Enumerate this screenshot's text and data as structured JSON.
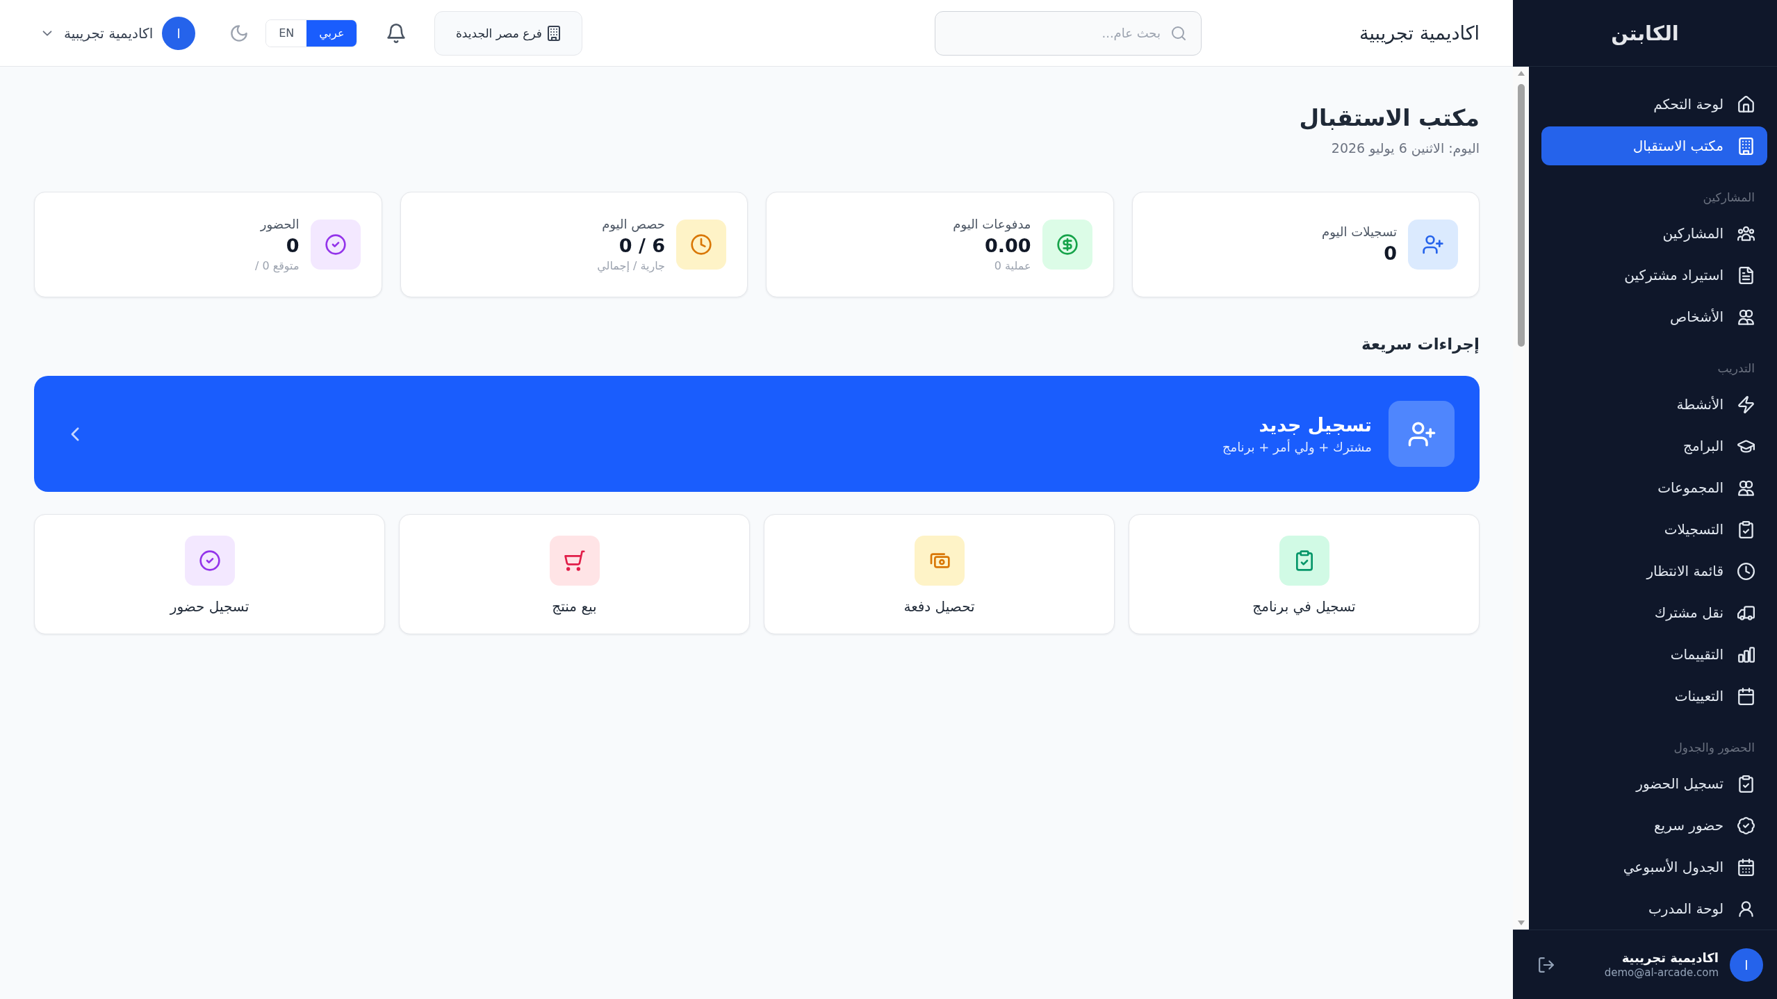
{
  "sidebar": {
    "brand": "الكابتن",
    "groups": [
      {
        "items": [
          {
            "label": "لوحة التحكم",
            "selected": false
          },
          {
            "label": "مكتب الاستقبال",
            "selected": true
          }
        ]
      },
      {
        "title": "المشاركين",
        "items": [
          {
            "label": "المشاركين",
            "selected": false
          },
          {
            "label": "استيراد مشتركين",
            "selected": false
          },
          {
            "label": "الأشخاص",
            "selected": false
          }
        ]
      },
      {
        "title": "التدريب",
        "items": [
          {
            "label": "الأنشطة",
            "selected": false
          },
          {
            "label": "البرامج",
            "selected": false
          },
          {
            "label": "المجموعات",
            "selected": false
          },
          {
            "label": "التسجيلات",
            "selected": false
          },
          {
            "label": "قائمة الانتظار",
            "selected": false
          },
          {
            "label": "نقل مشترك",
            "selected": false
          },
          {
            "label": "التقييمات",
            "selected": false
          },
          {
            "label": "التعيينات",
            "selected": false
          }
        ]
      },
      {
        "title": "الحضور والجدول",
        "items": [
          {
            "label": "تسجيل الحضور",
            "selected": false
          },
          {
            "label": "حضور سريع",
            "selected": false
          },
          {
            "label": "الجدول الأسبوعي",
            "selected": false
          },
          {
            "label": "لوحة المدرب",
            "selected": false
          }
        ]
      }
    ],
    "user": {
      "avatar": "ا",
      "name": "اكاديمية تجريبية",
      "email": "demo@al-arcade.com"
    }
  },
  "topbar": {
    "title": "اكاديمية تجريبية",
    "search": {
      "placeholder": "بحث عام..."
    },
    "branch": "فرع مصر الجديدة",
    "languages": [
      {
        "label": "عربي",
        "selected": true
      },
      {
        "label": "EN",
        "selected": false
      }
    ],
    "account": {
      "avatar": "ا",
      "name": "اكاديمية تجريبية"
    }
  },
  "page": {
    "title": "مكتب الاستقبال",
    "date": "اليوم: الاثنين 6 يوليو 2026"
  },
  "stats": [
    {
      "label": "تسجيلات اليوم",
      "value": "0"
    },
    {
      "label": "مدفوعات اليوم",
      "value": "0.00",
      "note": "عملية 0"
    },
    {
      "label": "حصص اليوم",
      "value": "0 / 6",
      "note": "جارية / إجمالي"
    },
    {
      "label": "الحضور",
      "value": "0",
      "note": "متوقع 0 /"
    }
  ],
  "quick_actions": {
    "title": "إجراءات سريعة",
    "featured": {
      "title": "تسجيل جديد",
      "subtitle": "مشترك + ولي أمر + برنامج"
    },
    "items": [
      {
        "label": "تسجيل في برنامج"
      },
      {
        "label": "تحصيل دفعة"
      },
      {
        "label": "بيع منتج"
      },
      {
        "label": "تسجيل حضور"
      }
    ]
  }
}
